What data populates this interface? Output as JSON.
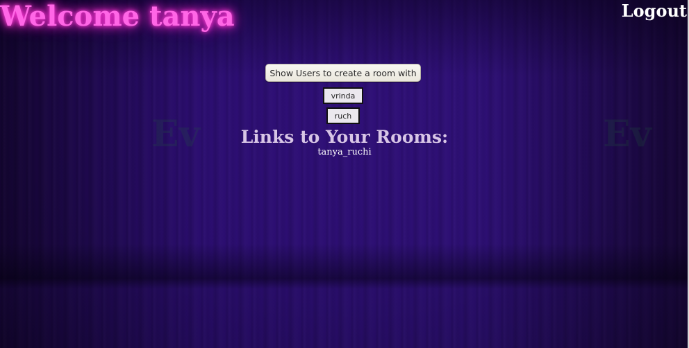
{
  "header": {
    "welcome_text": "Welcome tanya",
    "logout_label": "Logout"
  },
  "users": {
    "show_button_label": "Show Users to create a room with",
    "list": [
      "vrinda",
      "ruch"
    ]
  },
  "rooms": {
    "heading": "Links to Your Rooms:",
    "links": [
      "tanya_ruchi"
    ]
  },
  "colors": {
    "background": "#1e0a4a",
    "welcome_glow": "#ff66e6",
    "heading": "#d8c6e6"
  }
}
